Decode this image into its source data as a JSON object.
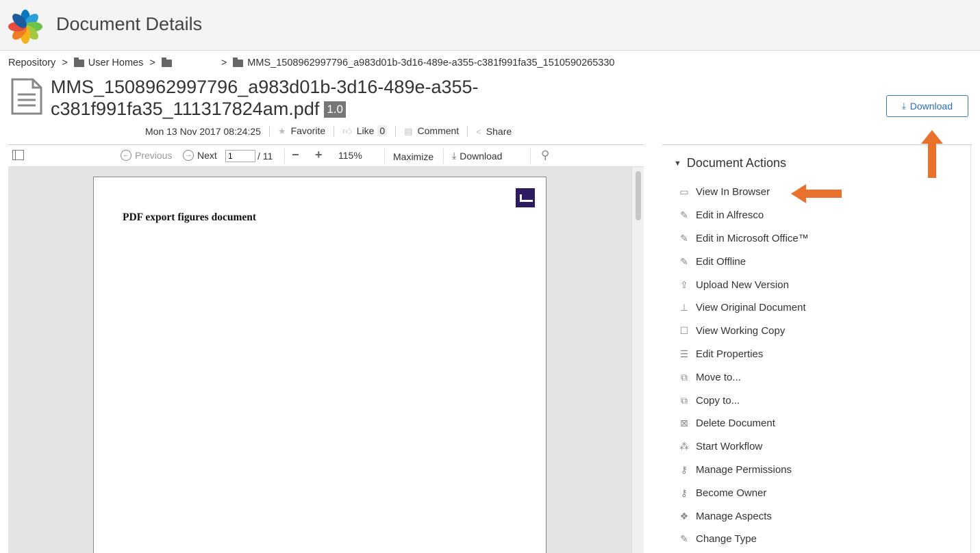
{
  "header": {
    "title": "Document Details"
  },
  "breadcrumb": {
    "repository": "Repository",
    "separator": ">",
    "user_homes": "User Homes",
    "current": "MMS_1508962997796_a983d01b-3d16-489e-a355-c381f991fa35_1510590265330"
  },
  "document": {
    "title_line1": "MMS_1508962997796_a983d01b-3d16-489e-a355-",
    "title_line2": "c381f991fa35_111317824am.pdf",
    "version": "1.0",
    "modified": "Mon 13 Nov 2017 08:24:25",
    "favorite_label": "Favorite",
    "like_label": "Like",
    "like_count": "0",
    "comment_label": "Comment",
    "share_label": "Share"
  },
  "download_button": {
    "label": "Download"
  },
  "viewer": {
    "previous": "Previous",
    "next": "Next",
    "page_value": "1",
    "page_total": "/ 11",
    "zoom": "115%",
    "maximize": "Maximize",
    "download": "Download",
    "page_heading": "PDF export figures document"
  },
  "actions": {
    "title": "Document Actions",
    "items": [
      {
        "label": "View In Browser",
        "icon": "browser-icon"
      },
      {
        "label": "Edit in Alfresco",
        "icon": "pencil-icon"
      },
      {
        "label": "Edit in Microsoft Office™",
        "icon": "pencil-icon"
      },
      {
        "label": "Edit Offline",
        "icon": "pencil-icon"
      },
      {
        "label": "Upload New Version",
        "icon": "upload-icon"
      },
      {
        "label": "View Original Document",
        "icon": "stamp-icon"
      },
      {
        "label": "View Working Copy",
        "icon": "edit-box-icon"
      },
      {
        "label": "Edit Properties",
        "icon": "properties-icon"
      },
      {
        "label": "Move to...",
        "icon": "move-icon"
      },
      {
        "label": "Copy to...",
        "icon": "copy-icon"
      },
      {
        "label": "Delete Document",
        "icon": "delete-icon"
      },
      {
        "label": "Start Workflow",
        "icon": "workflow-icon"
      },
      {
        "label": "Manage Permissions",
        "icon": "key-icon"
      },
      {
        "label": "Become Owner",
        "icon": "key-icon"
      },
      {
        "label": "Manage Aspects",
        "icon": "aspects-icon"
      },
      {
        "label": "Change Type",
        "icon": "pencil-icon"
      }
    ]
  },
  "colors": {
    "accent_blue": "#3b7bbf",
    "annotation_arrow": "#e8722c",
    "version_badge": "#777777"
  }
}
